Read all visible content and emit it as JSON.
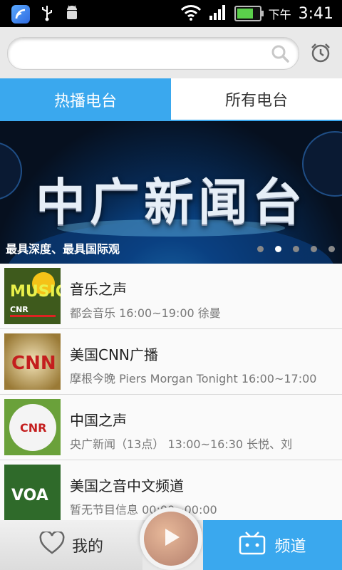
{
  "status_bar": {
    "ampm": "下午",
    "time": "3:41"
  },
  "search": {
    "placeholder": ""
  },
  "tabs": [
    {
      "label": "热播电台",
      "active": true
    },
    {
      "label": "所有电台",
      "active": false
    }
  ],
  "banner": {
    "title": "中广新闻台",
    "caption": "最具深度、最具国际观",
    "page_count": 5,
    "active_index": 1
  },
  "stations": [
    {
      "name": "音乐之声",
      "subtitle": "都会音乐    16:00~19:00    徐曼",
      "thumb": "music-radio-logo"
    },
    {
      "name": "美国CNN广播",
      "subtitle": "摩根今晚 Piers Morgan Tonight    16:00~17:00",
      "thumb": "cnn-logo"
    },
    {
      "name": "中国之声",
      "subtitle": "央广新闻（13点）    13:00~16:30    长悦、刘",
      "thumb": "cnr-golfball"
    },
    {
      "name": "美国之音中文频道",
      "subtitle": "暂无节目信息    00:00~00:00",
      "thumb": "voa-logo"
    }
  ],
  "bottom_nav": {
    "mine_label": "我的",
    "channels_label": "频道"
  },
  "colors": {
    "accent": "#3aa8ee",
    "statusbar": "#000000"
  }
}
